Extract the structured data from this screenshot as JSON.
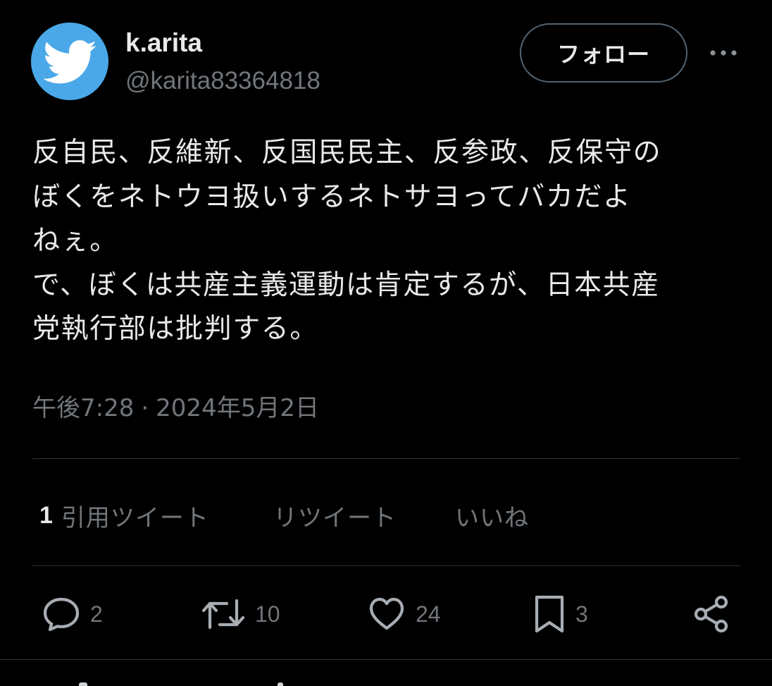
{
  "author": {
    "display_name": "k.arita",
    "handle": "@karita83364818",
    "avatar_icon": "twitter-bird-icon",
    "avatar_color": "#4aa8e8"
  },
  "header": {
    "follow_label": "フォロー",
    "more_icon": "more-dots-icon"
  },
  "tweet": {
    "lines": [
      "反自民、反維新、反国民民主、反参政、反保守の",
      "ぼくをネトウヨ扱いするネトサヨってバカだよ",
      "ねぇ。",
      "で、ぼくは共産主義運動は肯定するが、日本共産",
      "党執行部は批判する。"
    ],
    "time": "午後7:28",
    "separator": "·",
    "date": "2024年5月2日"
  },
  "stats": {
    "quotes_count": "1",
    "quotes_label": "引用ツイート",
    "retweets_label": "リツイート",
    "likes_label": "いいね"
  },
  "actions": {
    "replies": "2",
    "retweets": "10",
    "likes": "24",
    "bookmarks": "3"
  },
  "colors": {
    "background": "#000000",
    "text": "#e7e9ea",
    "secondary": "#71767b",
    "border": "#2f3336"
  }
}
